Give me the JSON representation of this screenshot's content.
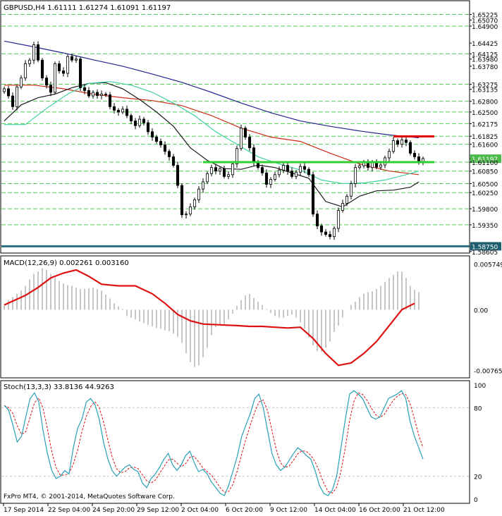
{
  "colors": {
    "background": "#ffffff",
    "frame": "#000000",
    "hline_green": "#55cc55",
    "price_tag": "#4cbb4c",
    "support_line": "#2a6f7f",
    "support_tag": "#1f5f6f",
    "resistance": "#e00000",
    "pivot_line": "#33cc33",
    "ma_blue": "#24248f",
    "ma_red": "#cc2a16",
    "ma_black": "#1a1a1a",
    "ma_teal": "#40d0a0",
    "macd_hist": "#a8a8a8",
    "macd_signal": "#dd1111",
    "stoch_main": "#28a0b8",
    "stoch_signal": "#dd1111",
    "grid": "#c8c8c8"
  },
  "chart_data": [
    {
      "type": "candlestick",
      "title": "GBPUSD,H4  1.61111  1.61274  1.61091  1.61197",
      "symbol": "GBPUSD",
      "timeframe": "H4",
      "ohlc_last": {
        "open": 1.61111,
        "high": 1.61274,
        "low": 1.61091,
        "close": 1.61197
      },
      "ylim": [
        1.5862,
        1.6555
      ],
      "price_levels": [
        "1.65225",
        "1.64900",
        "1.64425",
        "1.64125",
        "1.63780",
        "1.63275",
        "1.62800",
        "1.62500",
        "1.62175",
        "1.61825",
        "1.61600",
        "1.61100",
        "1.60850",
        "1.60500",
        "1.60250",
        "1.59800",
        "1.59350",
        "1.58750"
      ],
      "price_level_values": [
        1.65225,
        1.649,
        1.64125,
        1.63275,
        1.628,
        1.625,
        1.62175,
        1.61825,
        1.616,
        1.611,
        1.6085,
        1.605,
        1.6025,
        1.598,
        1.5935,
        1.5875
      ],
      "tick_labels": [
        "1.65225",
        "1.65070",
        "1.64900",
        "1.64425",
        "1.64125",
        "1.63980",
        "1.63780",
        "1.63275",
        "1.63135",
        "1.62800",
        "1.62500",
        "1.62175",
        "1.61825",
        "1.61600",
        "1.61197",
        "1.61100",
        "1.60850",
        "1.60500",
        "1.60250",
        "1.59800",
        "1.59350",
        "1.58750",
        "1.58605"
      ],
      "tick_values": [
        1.65225,
        1.6507,
        1.649,
        1.64425,
        1.64125,
        1.6398,
        1.6378,
        1.63275,
        1.63135,
        1.628,
        1.625,
        1.62175,
        1.61825,
        1.616,
        1.61197,
        1.611,
        1.6085,
        1.605,
        1.6025,
        1.598,
        1.5935,
        1.5875,
        1.58605
      ],
      "current_price": "1.61197",
      "support": "1.58750",
      "resistance_level": 1.6182,
      "pivot_level": 1.611,
      "x_labels": [
        "17 Sep 2014",
        "22 Sep 04:00",
        "24 Sep 20:00",
        "29 Sep 12:00",
        "2 Oct 04:00",
        "6 Oct 20:00",
        "9 Oct 12:00",
        "14 Oct 04:00",
        "16 Oct 20:00",
        "21 Oct 12:00"
      ],
      "series": [
        {
          "name": "candles",
          "closes": [
            1.6315,
            1.6295,
            1.6265,
            1.632,
            1.6345,
            1.6385,
            1.6395,
            1.6438,
            1.6395,
            1.6345,
            1.6325,
            1.6305,
            1.6385,
            1.6365,
            1.6358,
            1.6405,
            1.6395,
            1.6398,
            1.6318,
            1.631,
            1.6295,
            1.6305,
            1.6296,
            1.63,
            1.6298,
            1.6265,
            1.6255,
            1.625,
            1.6258,
            1.624,
            1.6225,
            1.6212,
            1.623,
            1.622,
            1.6195,
            1.618,
            1.6168,
            1.6158,
            1.614,
            1.6125,
            1.6101,
            1.6045,
            1.5963,
            1.5965,
            1.5985,
            1.6005,
            1.6035,
            1.6055,
            1.6078,
            1.6095,
            1.6085,
            1.6092,
            1.607,
            1.6075,
            1.6105,
            1.6148,
            1.6205,
            1.618,
            1.615,
            1.611,
            1.6095,
            1.608,
            1.6048,
            1.6062,
            1.6075,
            1.6088,
            1.6101,
            1.6085,
            1.607,
            1.6082,
            1.6098,
            1.609,
            1.6075,
            1.5965,
            1.5932,
            1.5915,
            1.5908,
            1.5902,
            1.5925,
            1.5975,
            1.5995,
            1.6015,
            1.605,
            1.6095,
            1.61,
            1.6108,
            1.6095,
            1.611,
            1.6096,
            1.6102,
            1.6122,
            1.614,
            1.617,
            1.616,
            1.6172,
            1.6165,
            1.6135,
            1.6125,
            1.6112,
            1.612
          ]
        },
        {
          "name": "ma_blue",
          "points": [
            [
              0,
              1.6448
            ],
            [
              7,
              1.6432
            ],
            [
              14,
              1.6415
            ],
            [
              21,
              1.6396
            ],
            [
              28,
              1.6378
            ],
            [
              35,
              1.6356
            ],
            [
              42,
              1.6333
            ],
            [
              49,
              1.6305
            ],
            [
              56,
              1.6275
            ],
            [
              63,
              1.6248
            ],
            [
              70,
              1.6225
            ],
            [
              77,
              1.621
            ],
            [
              84,
              1.6197
            ],
            [
              91,
              1.6186
            ],
            [
              98,
              1.6178
            ]
          ]
        },
        {
          "name": "ma_red",
          "points": [
            [
              0,
              1.6325
            ],
            [
              7,
              1.6325
            ],
            [
              14,
              1.6315
            ],
            [
              21,
              1.63
            ],
            [
              28,
              1.629
            ],
            [
              35,
              1.6282
            ],
            [
              42,
              1.6268
            ],
            [
              49,
              1.624
            ],
            [
              56,
              1.6205
            ],
            [
              63,
              1.618
            ],
            [
              70,
              1.6168
            ],
            [
              77,
              1.6135
            ],
            [
              84,
              1.6105
            ],
            [
              91,
              1.6085
            ],
            [
              98,
              1.6075
            ]
          ]
        },
        {
          "name": "ma_black",
          "points": [
            [
              0,
              1.6225
            ],
            [
              4,
              1.627
            ],
            [
              8,
              1.629
            ],
            [
              12,
              1.63
            ],
            [
              16,
              1.6318
            ],
            [
              20,
              1.633
            ],
            [
              24,
              1.6332
            ],
            [
              28,
              1.6315
            ],
            [
              32,
              1.6285
            ],
            [
              36,
              1.625
            ],
            [
              40,
              1.621
            ],
            [
              44,
              1.615
            ],
            [
              48,
              1.6115
            ],
            [
              52,
              1.6092
            ],
            [
              56,
              1.609
            ],
            [
              60,
              1.6102
            ],
            [
              64,
              1.6095
            ],
            [
              68,
              1.608
            ],
            [
              72,
              1.6065
            ],
            [
              76,
              1.6
            ],
            [
              80,
              1.5985
            ],
            [
              84,
              1.6015
            ],
            [
              88,
              1.603
            ],
            [
              92,
              1.6032
            ],
            [
              96,
              1.604
            ],
            [
              98,
              1.6055
            ]
          ]
        },
        {
          "name": "ma_teal",
          "points": [
            [
              0,
              1.6215
            ],
            [
              5,
              1.6215
            ],
            [
              10,
              1.626
            ],
            [
              15,
              1.63
            ],
            [
              20,
              1.633
            ],
            [
              25,
              1.6335
            ],
            [
              30,
              1.6325
            ],
            [
              35,
              1.6305
            ],
            [
              40,
              1.6275
            ],
            [
              45,
              1.624
            ],
            [
              50,
              1.6195
            ],
            [
              55,
              1.616
            ],
            [
              60,
              1.6125
            ],
            [
              65,
              1.6105
            ],
            [
              70,
              1.6088
            ],
            [
              75,
              1.606
            ],
            [
              80,
              1.605
            ],
            [
              85,
              1.6052
            ],
            [
              90,
              1.606
            ],
            [
              95,
              1.6075
            ],
            [
              98,
              1.6085
            ]
          ]
        }
      ]
    },
    {
      "type": "macd",
      "title": "MACD(12,26,9) 0.002261 0.003160",
      "label": "MACD(12,26,9)",
      "main_value": "0.002261",
      "signal_value": "0.003160",
      "ylim": [
        -0.0083,
        0.0065
      ],
      "tick_labels": [
        "0.005749",
        "0.00",
        "-0.00765"
      ],
      "tick_values": [
        0.005749,
        0.0,
        -0.00765
      ],
      "histogram": [
        0.0005,
        0.0012,
        0.0016,
        0.002,
        0.0024,
        0.003,
        0.0038,
        0.0045,
        0.0048,
        0.0052,
        0.005,
        0.0045,
        0.004,
        0.0036,
        0.0033,
        0.0031,
        0.003,
        0.0028,
        0.0026,
        0.0026,
        0.0027,
        0.0028,
        0.0026,
        0.0024,
        0.0019,
        0.0014,
        0.0008,
        0.0004,
        0.0001,
        -0.0008,
        -0.001,
        -0.0012,
        -0.0015,
        -0.0017,
        -0.0019,
        -0.0021,
        -0.0023,
        -0.0024,
        -0.0026,
        -0.0027,
        -0.003,
        -0.0034,
        -0.0042,
        -0.0055,
        -0.0066,
        -0.0072,
        -0.007,
        -0.006,
        -0.0048,
        -0.0032,
        -0.0022,
        -0.0018,
        -0.0018,
        -0.0012,
        -0.0005,
        0.0005,
        0.0012,
        0.0018,
        0.002,
        0.0015,
        0.001,
        0.0006,
        0.0001,
        -0.0004,
        -0.0008,
        -0.001,
        -0.001,
        -0.0008,
        -0.0006,
        -0.001,
        -0.0016,
        -0.0024,
        -0.0035,
        -0.0045,
        -0.0052,
        -0.0053,
        -0.0048,
        -0.004,
        -0.0028,
        -0.002,
        -0.001,
        0.0,
        0.0006,
        0.001,
        0.0016,
        0.002,
        0.0022,
        0.0023,
        0.0026,
        0.003,
        0.0035,
        0.004,
        0.0044,
        0.0048,
        0.0048,
        0.004,
        0.003,
        0.0025,
        0.0022
      ],
      "signal": [
        [
          0,
          0.0006
        ],
        [
          5,
          0.0018
        ],
        [
          8,
          0.0028
        ],
        [
          11,
          0.004
        ],
        [
          14,
          0.0046
        ],
        [
          17,
          0.005
        ],
        [
          20,
          0.0042
        ],
        [
          23,
          0.0032
        ],
        [
          27,
          0.003
        ],
        [
          31,
          0.003
        ],
        [
          35,
          0.002
        ],
        [
          38,
          0.0008
        ],
        [
          41,
          -0.0006
        ],
        [
          44,
          -0.0014
        ],
        [
          47,
          -0.0018
        ],
        [
          51,
          -0.0019
        ],
        [
          55,
          -0.002
        ],
        [
          58,
          -0.0021
        ],
        [
          61,
          -0.0021
        ],
        [
          64,
          -0.0022
        ],
        [
          67,
          -0.0023
        ],
        [
          70,
          -0.0022
        ],
        [
          73,
          -0.0036
        ],
        [
          76,
          -0.0055
        ],
        [
          79,
          -0.007
        ],
        [
          82,
          -0.0067
        ],
        [
          85,
          -0.0055
        ],
        [
          88,
          -0.004
        ],
        [
          91,
          -0.002
        ],
        [
          94,
          0.0
        ],
        [
          97,
          0.0008
        ]
      ]
    },
    {
      "type": "stochastic",
      "title": "Stoch(13,3,3) 33.8136 44.9263",
      "label": "Stoch(13,3,3)",
      "main_value": "33.8136",
      "signal_value": "44.9263",
      "ylim": [
        0,
        100
      ],
      "tick_labels": [
        "100",
        "80",
        "20",
        "0"
      ],
      "tick_values": [
        100,
        80,
        20,
        0
      ],
      "main": [
        82,
        78,
        65,
        50,
        55,
        72,
        88,
        93,
        85,
        60,
        40,
        25,
        18,
        20,
        25,
        22,
        45,
        62,
        70,
        85,
        88,
        83,
        70,
        50,
        35,
        25,
        20,
        24,
        28,
        30,
        26,
        24,
        14,
        10,
        18,
        22,
        28,
        35,
        40,
        30,
        25,
        30,
        38,
        42,
        32,
        24,
        26,
        22,
        15,
        10,
        5,
        3,
        12,
        25,
        38,
        55,
        65,
        75,
        88,
        92,
        80,
        60,
        40,
        30,
        25,
        28,
        34,
        40,
        45,
        42,
        38,
        35,
        25,
        12,
        5,
        3,
        8,
        20,
        45,
        70,
        92,
        95,
        92,
        88,
        80,
        72,
        70,
        72,
        80,
        88,
        90,
        92,
        95,
        88,
        68,
        55,
        45,
        35
      ]
    }
  ],
  "footer": {
    "copyright": "FxPro MT4, © 2001-2014, MetaQuotes Software Corp."
  }
}
